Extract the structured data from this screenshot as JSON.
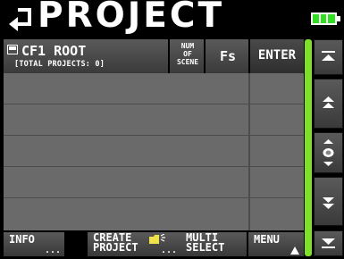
{
  "header": {
    "title": "PROJECT",
    "back_icon": "return-arrow-icon",
    "battery_icon": "battery-icon",
    "battery_color": "#33dd22"
  },
  "columns": {
    "root_label": "CF1 ROOT",
    "root_sublabel": "[TOTAL PROJECTS: 0]",
    "root_icon": "cf-card-icon",
    "num_of_scene": "NUM\nOF\nSCENE",
    "fs": "Fs",
    "enter": "ENTER"
  },
  "list": {
    "rows": [
      "",
      "",
      "",
      "",
      ""
    ]
  },
  "scrollbar": {
    "track_color": "#7fe02a",
    "buttons": [
      "jump-top-icon",
      "page-up-icon",
      "position-indicator-icon",
      "page-down-icon",
      "jump-bottom-icon"
    ]
  },
  "footer": {
    "info": "INFO",
    "create_project": "CREATE\nPROJECT",
    "multi_select": "MULTI\nSELECT",
    "menu": "MENU",
    "dots": "..."
  }
}
